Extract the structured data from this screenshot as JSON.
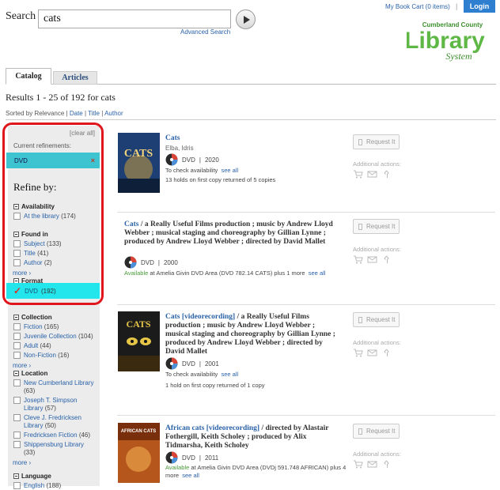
{
  "header": {
    "search_label": "Search",
    "search_value": "cats",
    "advanced_search": "Advanced Search",
    "book_cart": "My Book Cart (0 items)",
    "separator": "|",
    "login": "Login",
    "logo_text_top": "Cumberland County",
    "logo_text_main": "Library",
    "logo_text_bottom": "System"
  },
  "tabs": [
    {
      "label": "Catalog",
      "active": true
    },
    {
      "label": "Articles",
      "active": false
    }
  ],
  "results_summary": "Results 1 - 25 of 192 for cats",
  "sort": {
    "label": "Sorted by",
    "options": [
      "Relevance",
      "Date",
      "Title",
      "Author"
    ],
    "separator": "|"
  },
  "sidebar": {
    "clear_all": "[clear all]",
    "current_label": "Current refinements:",
    "current_value": "DVD",
    "remove_glyph": "×",
    "refine_heading": "Refine by:",
    "facets": {
      "availability": {
        "title": "Availability",
        "items": [
          {
            "label": "At the library",
            "count": "(174)"
          }
        ]
      },
      "found_in": {
        "title": "Found in",
        "items": [
          {
            "label": "Subject",
            "count": "(133)"
          },
          {
            "label": "Title",
            "count": "(41)"
          },
          {
            "label": "Author",
            "count": "(2)"
          }
        ],
        "more": "more"
      },
      "format": {
        "title": "Format",
        "selected": {
          "label": "DVD",
          "count": "(192)"
        }
      },
      "collection": {
        "title": "Collection",
        "items": [
          {
            "label": "Fiction",
            "count": "(165)"
          },
          {
            "label": "Juvenile Collection",
            "count": "(104)"
          },
          {
            "label": "Adult",
            "count": "(44)"
          },
          {
            "label": "Non-Fiction",
            "count": "(16)"
          }
        ],
        "more": "more"
      },
      "location": {
        "title": "Location",
        "items": [
          {
            "label": "New Cumberland Library",
            "count": "(63)"
          },
          {
            "label": "Joseph T. Simpson Library",
            "count": "(57)"
          },
          {
            "label": "Cleve J. Fredricksen Library",
            "count": "(50)"
          },
          {
            "label": "Fredricksen Fiction",
            "count": "(46)"
          },
          {
            "label": "Shippensburg Library",
            "count": "(33)"
          }
        ],
        "more": "more"
      },
      "language": {
        "title": "Language",
        "items": [
          {
            "label": "English",
            "count": "(188)"
          }
        ]
      }
    }
  },
  "results": [
    {
      "title": "Cats",
      "resp": "",
      "author": "Elba, Idris",
      "format": "DVD",
      "sep": "|",
      "year": "2020",
      "availability_prefix": "To check availability",
      "availability_link": "see all",
      "holds": "13 holds on first copy returned of 5 copies",
      "request": "Request It",
      "additional": "Additional actions:",
      "cover_text": "CATS",
      "cover_color": "#1e3f74"
    },
    {
      "title": "Cats",
      "resp": " / a Really Useful Films production ; music by Andrew Lloyd Webber ; musical staging and choreography by Gillian Lynne ; produced by Andrew Lloyd Webber ; directed by David Mallet",
      "author": "",
      "format": "DVD",
      "sep": "|",
      "year": "2000",
      "availability_green": "Available",
      "availability_prefix": " at Amelia Givin DVD Area (DVD 782.14 CATS) plus 1 more",
      "availability_link": "see all",
      "holds": "",
      "request": "Request It",
      "additional": "Additional actions:"
    },
    {
      "title": "Cats [videorecording]",
      "resp": " / a Really Useful Films production ; music by Andrew Lloyd Webber ; musical staging and choreography by Gillian Lynne ; produced by Andrew Lloyd Webber ; directed by David Mallet",
      "author": "",
      "format": "DVD",
      "sep": "|",
      "year": "2001",
      "availability_prefix": "To check availability",
      "availability_link": "see all",
      "holds": "1 hold on first copy returned of 1 copy",
      "request": "Request It",
      "additional": "Additional actions:",
      "cover_text": "CATS",
      "cover_color": "#1b1b1b"
    },
    {
      "title": "African cats [videorecording]",
      "resp": " / directed by Alastair Fothergill, Keith Scholey ; produced by Alix Tidmarsha, Keith Scholey",
      "author": "",
      "format": "DVD",
      "sep": "|",
      "year": "2011",
      "availability_green": "Available",
      "availability_prefix": " at Amelia Givin DVD Area (DVDj 591.748 AFRICAN) plus 4 more",
      "availability_link": "see all",
      "holds": "",
      "request": "Request It",
      "additional": "Additional actions:",
      "cover_text": "AFRICAN CATS",
      "cover_color": "#b5561c"
    }
  ]
}
